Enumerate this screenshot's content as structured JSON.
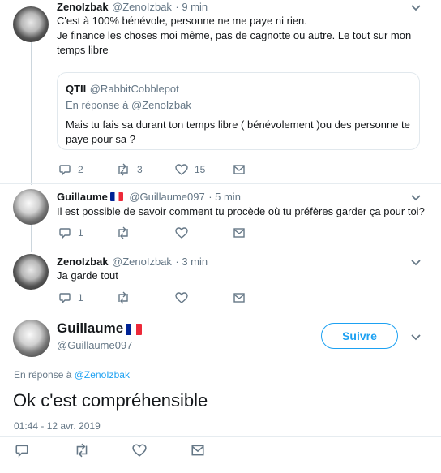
{
  "tweets": [
    {
      "name": "ZenoIzbak",
      "handle": "@ZenoIzbak",
      "time": "· 9 min",
      "lines": [
        "C'est à 100% bénévole, personne ne me paye ni rien.",
        "Je finance les choses moi même, pas de cagnotte ou autre. Le tout sur mon",
        "temps libre"
      ],
      "quote": {
        "name": "QTII",
        "handle": "@RabbitCobblepot",
        "reply_prefix": "En réponse à",
        "reply_to": "@ZenoIzbak",
        "lines": [
          "Mais tu fais sa durant ton temps libre ( bénévolement )ou des personne te",
          "paye pour sa ?"
        ]
      },
      "replies": "2",
      "retweets": "3",
      "likes": "15"
    },
    {
      "name": "Guillaume",
      "handle": "@Guillaume097",
      "time": "· 5 min",
      "text": "Il est possible de savoir comment tu procède où tu préfères garder ça pour toi?",
      "replies": "1"
    },
    {
      "name": "ZenoIzbak",
      "handle": "@ZenoIzbak",
      "time": "· 3 min",
      "text": "Ja garde tout",
      "replies": "1"
    }
  ],
  "focused": {
    "name": "Guillaume",
    "handle": "@Guillaume097",
    "follow_label": "Suivre",
    "reply_prefix": "En réponse à",
    "reply_to": "@ZenoIzbak",
    "text": "Ok c'est compréhensible",
    "timestamp": "01:44 - 12 avr. 2019"
  },
  "colors": {
    "accent": "#1da1f2",
    "text": "#14171a",
    "secondary": "#657786",
    "thread_line": "#ccd6dd",
    "flag": [
      "#002395",
      "#ffffff",
      "#ed2939"
    ]
  },
  "icons": [
    "reply-icon",
    "retweet-icon",
    "like-icon",
    "message-icon",
    "chevron-down-icon",
    "france-flag-icon"
  ]
}
